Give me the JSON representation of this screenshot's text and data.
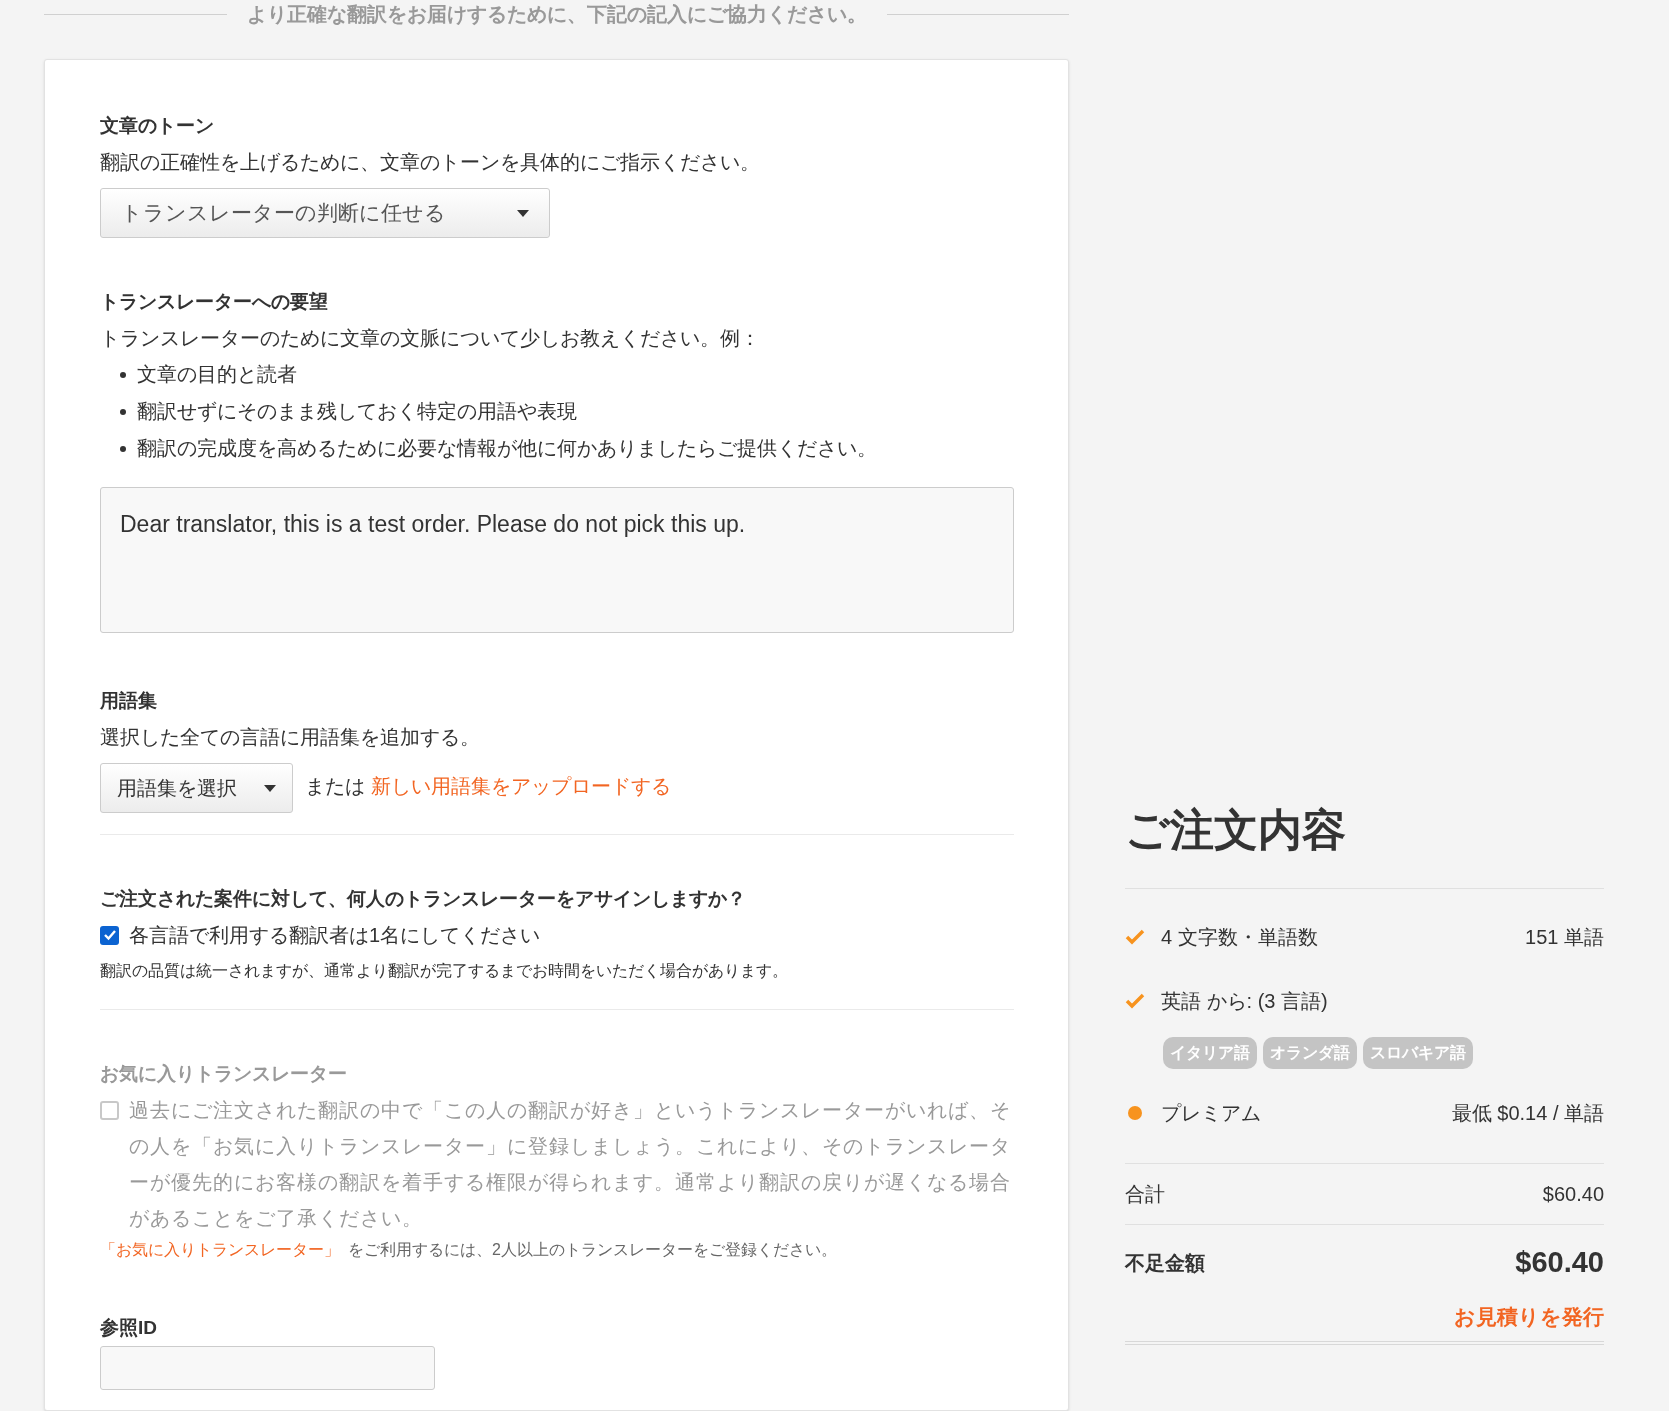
{
  "banner": "より正確な翻訳をお届けするために、下記の記入にご協力ください。",
  "tone": {
    "heading": "文章のトーン",
    "description": "翻訳の正確性を上げるために、文章のトーンを具体的にご指示ください。",
    "select": "トランスレーターの判断に任せる"
  },
  "request": {
    "heading": "トランスレーターへの要望",
    "description": "トランスレーターのために文章の文脈について少しお教えください。例：",
    "bullets": [
      "文章の目的と読者",
      "翻訳せずにそのまま残しておく特定の用語や表現",
      "翻訳の完成度を高めるために必要な情報が他に何かありましたらご提供ください。"
    ],
    "value": "Dear translator, this is a test order. Please do not pick this up."
  },
  "glossary": {
    "heading": "用語集",
    "description": "選択した全ての言語に用語集を追加する。",
    "select": "用語集を選択",
    "or": "または",
    "link": "新しい用語集をアップロードする"
  },
  "translators": {
    "heading": "ご注文された案件に対して、何人のトランスレーターをアサインしますか？",
    "checkbox": {
      "label": "各言語で利用する翻訳者は1名にしてください",
      "checked": true,
      "disabled": false
    },
    "note": "翻訳の品質は統一されますが、通常より翻訳が完了するまでお時間をいただく場合があります。"
  },
  "favorites": {
    "heading": "お気に入りトランスレーター",
    "checkbox": {
      "label": "過去にご注文された翻訳の中で「この人の翻訳が好き」というトランスレーターがいれば、その人を「お気に入りトランスレーター」に登録しましょう。これにより、そのトランスレーターが優先的にお客様の翻訳を着手する権限が得られます。通常より翻訳の戻りが遅くなる場合があることをご了承ください。",
      "checked": false,
      "disabled": true
    },
    "link": "「お気に入りトランスレーター」",
    "note": "をご利用するには、2人以上のトランスレーターをご登録ください。"
  },
  "reference": {
    "heading": "参照ID"
  },
  "summary": {
    "title": "ご注文内容",
    "items": [
      {
        "kind": "check",
        "label": "4 文字数・単語数",
        "value": "151 単語"
      },
      {
        "kind": "check",
        "label": "英語 から: (3 言語)",
        "tags": [
          "イタリア語",
          "オランダ語",
          "スロバキア語"
        ]
      },
      {
        "kind": "dot",
        "color": "#f7931e",
        "label": "プレミアム",
        "value": "最低 $0.14 / 単語"
      }
    ],
    "subtotal_label": "合計",
    "subtotal": "$60.40",
    "due_label": "不足金額",
    "due": "$60.40",
    "quote_link": "お見積りを発行"
  }
}
